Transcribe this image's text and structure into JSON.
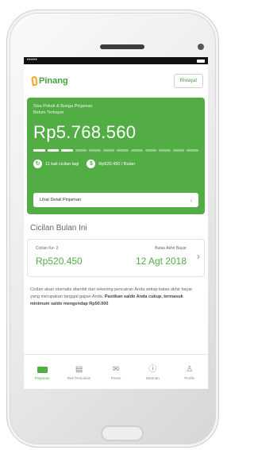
{
  "status_bar": {
    "signal": "•••••"
  },
  "app": {
    "logo": "Pinang",
    "history_button": "Riwayat"
  },
  "loan_card": {
    "label_line1": "Sisa Pokok & Bunga Pinjaman",
    "label_line2": "Belum Terbayar",
    "amount": "Rp5.768.560",
    "progress_filled": 3,
    "progress_total": 12,
    "installments_left": "11 kali cicilan lagi",
    "monthly": "Rp520.450 / Bulan",
    "detail_button": "Lihat Detail Pinjaman"
  },
  "installment_section": {
    "title": "Cicilan Bulan Ini",
    "installment_label": "Cicilan Ke- 2",
    "installment_amount": "Rp520.450",
    "due_label": "Batas Akhir Bayar",
    "due_date": "12 Agt 2018"
  },
  "info_text": {
    "normal": "Cicilan akan otomatis diambil dari rekening pencairan Anda setiap batas akhir bayar yang merupakan tanggal gajian Anda. ",
    "bold": "Pastikan saldo Anda cukup, termasuk minimum saldo mengendap Rp50.000"
  },
  "bottom_nav": [
    {
      "label": "Pinjaman",
      "icon": "loan-icon"
    },
    {
      "label": "Rek Pencairan",
      "icon": "bank-card-icon"
    },
    {
      "label": "Pesan",
      "icon": "message-icon"
    },
    {
      "label": "Bantuan",
      "icon": "help-icon"
    },
    {
      "label": "Profile",
      "icon": "profile-icon"
    }
  ],
  "colors": {
    "primary": "#53ad45",
    "logo_accent": "#f5a623"
  }
}
